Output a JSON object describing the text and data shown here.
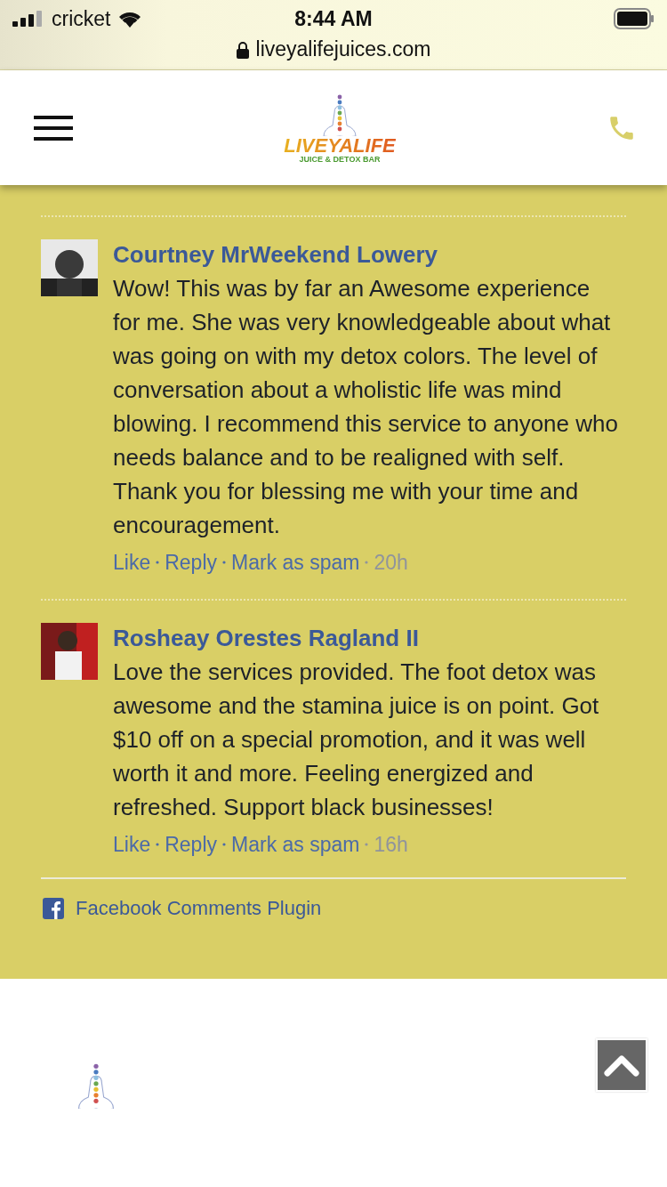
{
  "status_bar": {
    "carrier": "cricket",
    "time": "8:44 AM",
    "url": "liveyalifejuices.com"
  },
  "header": {
    "logo_title": "LIVEYALIFE",
    "logo_tagline": "JUICE & DETOX BAR"
  },
  "comments": [
    {
      "author": "Courtney MrWeekend Lowery",
      "body": "Wow! This was by far an Awesome experience for me. She was very knowledgeable about what was going on with my detox colors. The level of conversation about a wholistic life was mind blowing. I recommend this service to anyone who needs balance and to be realigned with self. Thank you for blessing me with your time and encouragement.",
      "actions": [
        "Like",
        "Reply",
        "Mark as spam"
      ],
      "age": "20h"
    },
    {
      "author": "Rosheay Orestes Ragland II",
      "body": "Love the services provided. The foot detox was awesome and the stamina juice is on point. Got $10 off on a special promotion, and it was well worth it and more. Feeling energized and refreshed. Support black businesses!",
      "actions": [
        "Like",
        "Reply",
        "Mark as spam"
      ],
      "age": "16h"
    }
  ],
  "plugin_label": "Facebook Comments Plugin"
}
